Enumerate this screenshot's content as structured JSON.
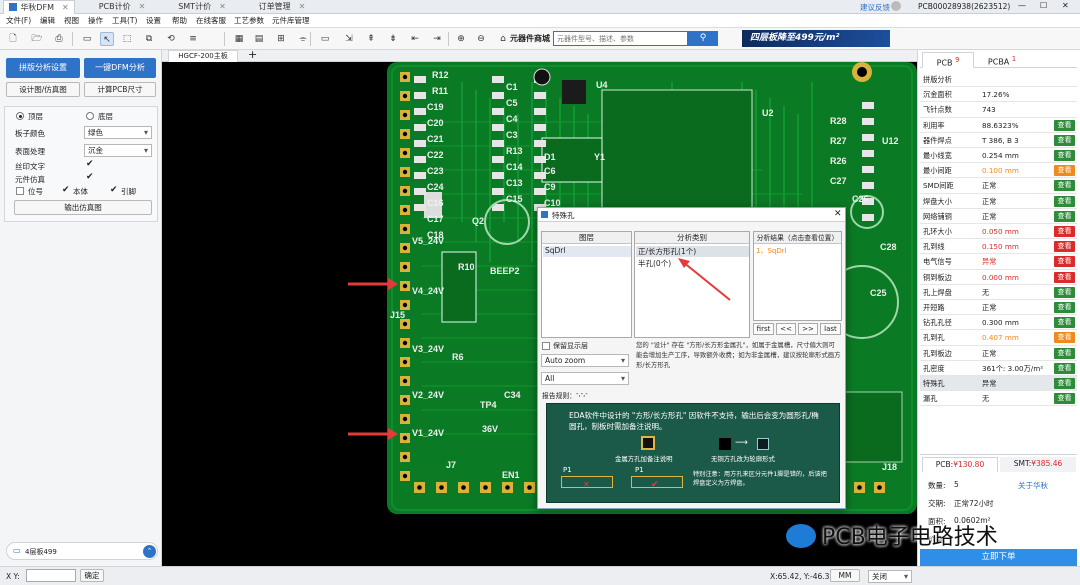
{
  "window": {
    "app_tab": "华秋DFM",
    "tabs": [
      "PCB计价",
      "SMT计价",
      "订单管理"
    ],
    "feedback": "建议反馈",
    "account": "PCB00028938(2623512)",
    "win_ctrl": [
      "—",
      "☐",
      "✕"
    ]
  },
  "menu": [
    "文件(F)",
    "编辑",
    "视图",
    "操作",
    "工具(T)",
    "设置",
    "帮助",
    "在线客服",
    "工艺参数",
    "元件库管理"
  ],
  "toolbar": {
    "icons": [
      "new-icon",
      "open-icon",
      "print-icon",
      "select-icon",
      "pointer-icon",
      "zoom-area-icon",
      "copy-icon",
      "rotate-icon",
      "align-icon",
      "layer-icon",
      "grid-icon",
      "measure-icon",
      "drc-icon",
      "component-icon",
      "export-icon",
      "move-up-icon",
      "move-down-icon",
      "move-left-icon",
      "move-right-icon",
      "zoom-in-icon",
      "zoom-out-icon",
      "home-icon",
      "undo-icon",
      "redo-icon",
      "pan-icon"
    ],
    "glyphs": [
      "🗋",
      "🗁",
      "⎙",
      "▭",
      "↖",
      "⬚",
      "⧉",
      "⟲",
      "≡",
      "▦",
      "▤",
      "⊞",
      "⌯",
      "▭",
      "⇲",
      "⇞",
      "⇟",
      "⇤",
      "⇥",
      "⊕",
      "⊖",
      "⌂",
      "↶",
      "↷",
      "✥"
    ],
    "component_mall": "元器件商城",
    "search_placeholder": "元器件型号、描述、参数",
    "banner": "四层板降至499元/m²"
  },
  "doc_tab": "HGCF-200主板",
  "left": {
    "btn_pack": "拼版分析设置",
    "btn_dfm": "一键DFM分析",
    "btn_design": "设计图/仿真图",
    "btn_calc": "计算PCB尺寸",
    "top": "顶层",
    "bottom": "底层",
    "board_color_label": "板子颜色",
    "board_color": "绿色",
    "surface_label": "表面处理",
    "surface": "沉金",
    "silk_label": "丝印文字",
    "sim_label": "元件仿真",
    "cb_pos": "位号",
    "cb_body": "本体",
    "cb_pin": "引脚",
    "export_btn": "输出仿真图",
    "notice": "4层板499"
  },
  "right": {
    "tab_pcb": "PCB",
    "tab_pcb_count": "9",
    "tab_pcba": "PCBA",
    "tab_pcba_count": "1",
    "rows": [
      {
        "k": "拼版分析",
        "v": "",
        "btn": ""
      },
      {
        "k": "沉金面积",
        "v": "17.26%",
        "btn": ""
      },
      {
        "k": "飞针点数",
        "v": "743",
        "btn": ""
      },
      {
        "k": "利用率",
        "v": "88.6323%",
        "btn": "查看",
        "c": "#2e8b3a"
      },
      {
        "k": "器件焊点",
        "v": "T 386, B 3",
        "btn": "查看",
        "c": "#2e8b3a"
      },
      {
        "k": "最小线宽",
        "v": "0.254 mm",
        "btn": "查看",
        "c": "#2e8b3a"
      },
      {
        "k": "最小间距",
        "v": "0.100 mm",
        "btn": "查看",
        "c": "#ef8b1c",
        "vc": "#ef8b1c"
      },
      {
        "k": "SMD间距",
        "v": "正常",
        "btn": "查看",
        "c": "#2e8b3a"
      },
      {
        "k": "焊盘大小",
        "v": "正常",
        "btn": "查看",
        "c": "#2e8b3a"
      },
      {
        "k": "网络铺铜",
        "v": "正常",
        "btn": "查看",
        "c": "#2e8b3a"
      },
      {
        "k": "孔环大小",
        "v": "0.050 mm",
        "btn": "查看",
        "c": "#d92b2b",
        "vc": "#d92b2b"
      },
      {
        "k": "孔到线",
        "v": "0.150 mm",
        "btn": "查看",
        "c": "#d92b2b",
        "vc": "#d92b2b"
      },
      {
        "k": "电气信号",
        "v": "异常",
        "btn": "查看",
        "c": "#d92b2b",
        "vc": "#d92b2b"
      },
      {
        "k": "铜到板边",
        "v": "0.000 mm",
        "btn": "查看",
        "c": "#d92b2b",
        "vc": "#d92b2b"
      },
      {
        "k": "孔上焊盘",
        "v": "无",
        "btn": "查看",
        "c": "#2e8b3a"
      },
      {
        "k": "开短路",
        "v": "正常",
        "btn": "查看",
        "c": "#2e8b3a"
      },
      {
        "k": "钻孔孔径",
        "v": "0.300 mm",
        "btn": "查看",
        "c": "#2e8b3a"
      },
      {
        "k": "孔到孔",
        "v": "0.407 mm",
        "btn": "查看",
        "c": "#ef8b1c",
        "vc": "#ef8b1c"
      },
      {
        "k": "孔到板边",
        "v": "正常",
        "btn": "查看",
        "c": "#2e8b3a"
      },
      {
        "k": "孔密度",
        "v": "361个: 3.00万/m²",
        "btn": "查看",
        "c": "#2e8b3a"
      },
      {
        "k": "特殊孔",
        "v": "异常",
        "btn": "查看",
        "c": "#2e8b3a",
        "hl": true
      },
      {
        "k": "漏孔",
        "v": "无",
        "btn": "查看",
        "c": "#2e8b3a"
      }
    ],
    "price_pcb_label": "PCB:",
    "price_pcb": "¥130.80",
    "price_smt_label": "SMT:",
    "price_smt": "¥385.46",
    "qty_label": "数量:",
    "qty": "5",
    "about": "关于华秋",
    "lead_label": "交期:",
    "lead": "正常72小时",
    "area_label": "面积:",
    "area": "0.0602m²",
    "price_label": "价格:",
    "order_btn": "立即下单"
  },
  "status": {
    "xy_label": "X Y:",
    "confirm": "确定",
    "coords": "X:65.42, Y:-46.33",
    "unit": "MM",
    "close": "关闭"
  },
  "dialog": {
    "title": "特殊孔",
    "col_layer": "图层",
    "col_type": "分析类别",
    "col_result": "分析结果（点击查看位置）",
    "layer_item": "SqDrl",
    "type_items": [
      "正/长方形孔(1个)",
      "半孔(0个)"
    ],
    "result_item": "1、SqDrl",
    "nav": [
      "first",
      "<<",
      ">>",
      "last"
    ],
    "keep_layer": "保留显示层",
    "zoom": "Auto zoom",
    "filter": "All",
    "report_label": "报告规则：",
    "report_val": "-,-,-",
    "desc": "您的 \"设计\" 存在 \"方形/长方形金属孔\"，如属于金属槽，尺寸偏大则可能会增加生产工序，导致额外收费；如为非金属槽，建议按轮廓形式画方形/长方形孔",
    "info_title": "EDA软件中设计的 \"方形/长方形孔\" 因软件不支持，输出后会变为圆形孔/椭圆孔，制板时需加备注说明。",
    "info_a": "金属方孔加备注说明",
    "info_b": "无铜方孔改为轮廓形式",
    "info_p1": "P1",
    "info_p1b": "P1",
    "info_note": "特别注意：用方孔来区分元件1脚是错的，后该把焊盘定义为方焊盘。"
  },
  "pcb_labels": [
    "R12",
    "R11",
    "C19",
    "C20",
    "C21",
    "C22",
    "C23",
    "C24",
    "C16",
    "C17",
    "C18",
    "C1",
    "C5",
    "C4",
    "C3",
    "R13",
    "C14",
    "C13",
    "C15",
    "D1",
    "C6",
    "C9",
    "C10",
    "Y1",
    "U4",
    "U2",
    "R28",
    "R27",
    "R26",
    "C27",
    "C26",
    "U12",
    "J15",
    "J7",
    "J18",
    "R10",
    "Q2",
    "BEEP2",
    "C34",
    "R6",
    "C28",
    "C25",
    "V5_24V",
    "V4_24V",
    "V3_24V",
    "V2_24V",
    "V1_24V",
    "36V",
    "TP4",
    "EN1"
  ],
  "watermark": "PCB电子电路技术"
}
